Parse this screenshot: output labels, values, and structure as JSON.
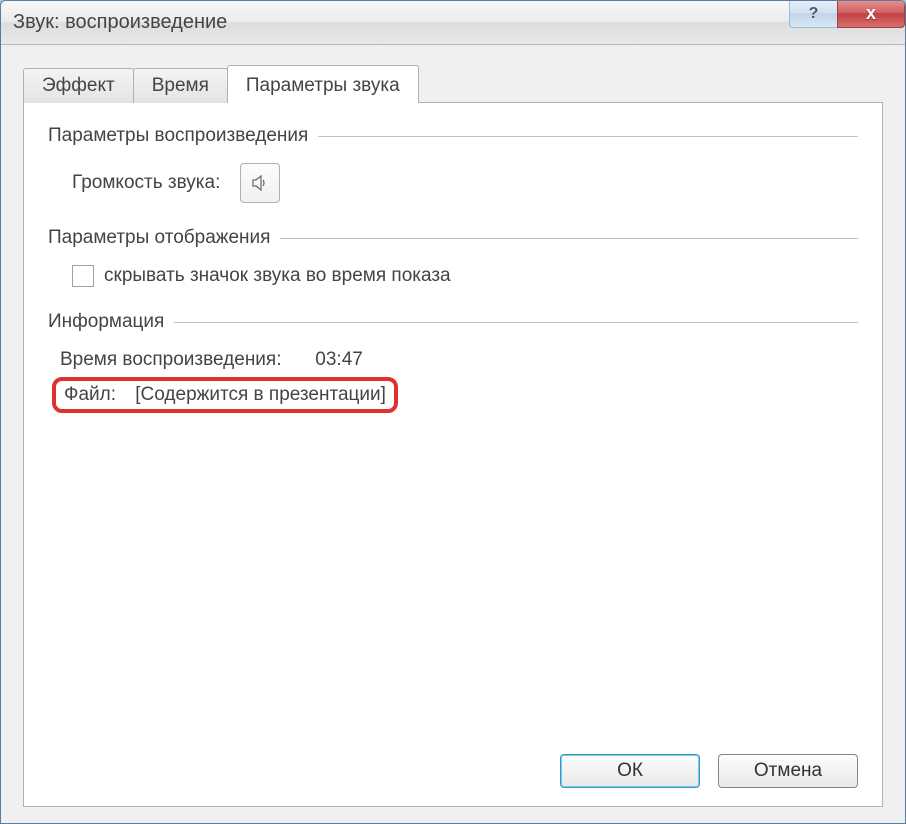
{
  "window": {
    "title": "Звук: воспроизведение"
  },
  "tabs": [
    {
      "label": "Эффект"
    },
    {
      "label": "Время"
    },
    {
      "label": "Параметры звука"
    }
  ],
  "groups": {
    "playback": {
      "title": "Параметры воспроизведения",
      "volume_label": "Громкость звука:"
    },
    "display": {
      "title": "Параметры отображения",
      "hide_icon_label": "скрывать значок звука во время показа"
    },
    "info": {
      "title": "Информация",
      "duration_label": "Время воспроизведения:",
      "duration_value": "03:47",
      "file_label": "Файл:",
      "file_value": "[Содержится в презентации]"
    }
  },
  "buttons": {
    "ok": "ОК",
    "cancel": "Отмена"
  },
  "icons": {
    "help": "?",
    "close": "x"
  }
}
